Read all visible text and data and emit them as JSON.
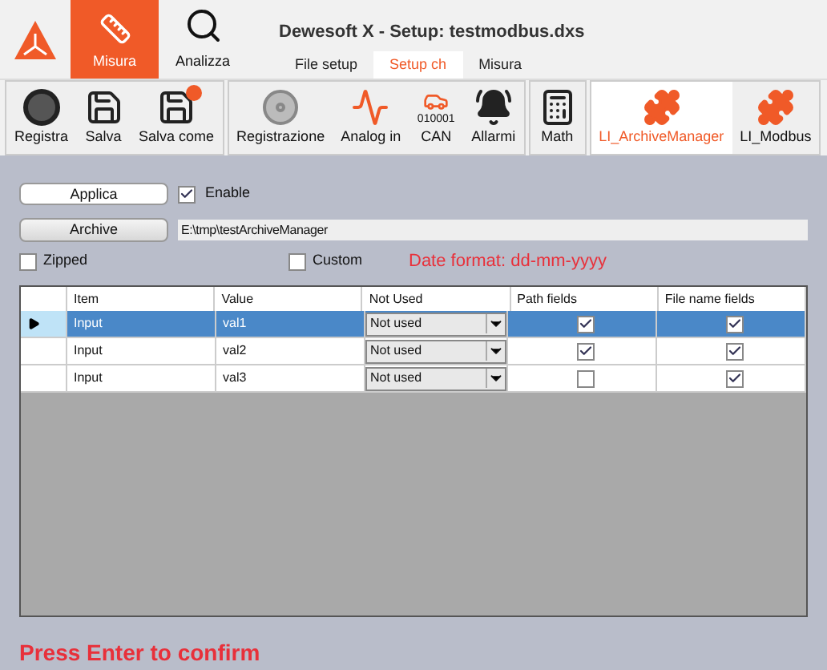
{
  "header": {
    "title": "Dewesoft X - Setup: testmodbus.dxs",
    "modes": [
      {
        "label": "Misura",
        "kind": "ruler",
        "selected": true
      },
      {
        "label": "Analizza",
        "kind": "search",
        "selected": false
      }
    ],
    "tabs": [
      {
        "label": "File setup",
        "selected": false
      },
      {
        "label": "Setup ch",
        "selected": true
      },
      {
        "label": "Misura",
        "selected": false
      }
    ]
  },
  "toolbar": [
    {
      "items": [
        {
          "label": "Registra",
          "kind": "record",
          "selected": false
        },
        {
          "label": "Salva",
          "kind": "save",
          "selected": false
        },
        {
          "label": "Salva come",
          "kind": "saveas",
          "selected": false
        }
      ]
    },
    {
      "items": [
        {
          "label": "Registrazione",
          "kind": "disc",
          "selected": false
        },
        {
          "label": "Analog in",
          "kind": "wave",
          "selected": false
        },
        {
          "label": "CAN",
          "kind": "car",
          "caption": "010001",
          "selected": false
        },
        {
          "label": "Allarmi",
          "kind": "bell",
          "selected": false
        }
      ]
    },
    {
      "items": [
        {
          "label": "Math",
          "kind": "math",
          "selected": false
        }
      ]
    },
    {
      "items": [
        {
          "label": "LI_ArchiveManager",
          "kind": "puzzle",
          "selected": true
        },
        {
          "label": "LI_Modbus",
          "kind": "puzzle",
          "selected": false
        }
      ]
    }
  ],
  "form": {
    "apply_button": "Applica",
    "enable": {
      "label": "Enable",
      "checked": true
    },
    "archive_button": "Archive",
    "path": "E:\\tmp\\testArchiveManager",
    "zipped": {
      "label": "Zipped",
      "checked": false
    },
    "custom": {
      "label": "Custom",
      "checked": false
    },
    "date_format": "Date format:  dd-mm-yyyy"
  },
  "table": {
    "columns": [
      "Item",
      "Value",
      "Not Used",
      "Path fields",
      "File name fields"
    ],
    "rows": [
      {
        "item": "Input",
        "value": "val1",
        "not_used": "Not used",
        "path": true,
        "file_name": true,
        "selected": true
      },
      {
        "item": "Input",
        "value": "val2",
        "not_used": "Not used",
        "path": true,
        "file_name": true,
        "selected": false
      },
      {
        "item": "Input",
        "value": "val3",
        "not_used": "Not used",
        "path": false,
        "file_name": true,
        "selected": false
      }
    ]
  },
  "status": "Press Enter to confirm"
}
